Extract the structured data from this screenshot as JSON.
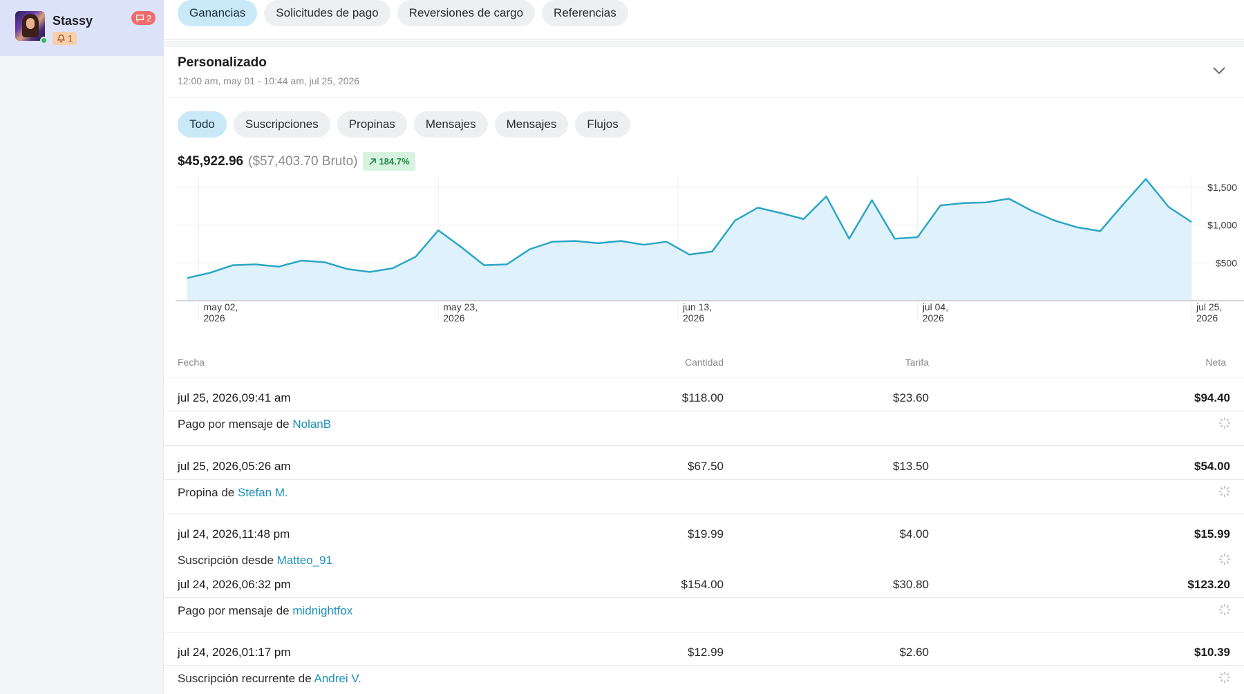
{
  "account": {
    "name": "Stassy",
    "messages_count": "2",
    "notifications_count": "1"
  },
  "tabs": [
    "Ganancias",
    "Solicitudes de pago",
    "Reversiones de cargo",
    "Referencias"
  ],
  "active_tab": "Ganancias",
  "range": {
    "title": "Personalizado",
    "subtitle": "12:00 am, may 01 - 10:44 am, jul 25, 2026"
  },
  "filters": [
    "Todo",
    "Suscripciones",
    "Propinas",
    "Mensajes",
    "Mensajes",
    "Flujos"
  ],
  "active_filter": "Todo",
  "summary": {
    "net": "$45,922.96",
    "gross": "($57,403.70 Bruto)",
    "trend": "184.7%"
  },
  "colors": {
    "accent": "#2aa6c4",
    "area_fill": "#dff1fb",
    "pill_active": "#c9e8f8",
    "link": "#1b8fb8"
  },
  "chart_data": {
    "type": "area",
    "x": [
      "may 01",
      "may 03",
      "may 05",
      "may 07",
      "may 09",
      "may 11",
      "may 13",
      "may 15",
      "may 17",
      "may 19",
      "may 21",
      "may 23",
      "may 25",
      "may 27",
      "may 29",
      "may 31",
      "jun 02",
      "jun 04",
      "jun 06",
      "jun 08",
      "jun 10",
      "jun 12",
      "jun 14",
      "jun 16",
      "jun 18",
      "jun 20",
      "jun 22",
      "jun 24",
      "jun 26",
      "jun 28",
      "jun 30",
      "jul 02",
      "jul 04",
      "jul 06",
      "jul 08",
      "jul 10",
      "jul 12",
      "jul 14",
      "jul 16",
      "jul 18",
      "jul 20",
      "jul 22",
      "jul 24",
      "jul 25"
    ],
    "values": [
      300,
      370,
      470,
      480,
      450,
      530,
      510,
      420,
      380,
      430,
      580,
      930,
      710,
      470,
      480,
      680,
      780,
      790,
      760,
      790,
      740,
      780,
      610,
      650,
      1060,
      1230,
      1160,
      1080,
      1380,
      820,
      1330,
      820,
      840,
      1260,
      1290,
      1300,
      1350,
      1190,
      1060,
      970,
      920,
      1270,
      1610,
      1240,
      1040
    ],
    "ylim": [
      0,
      1600
    ],
    "yticks": [
      "$500",
      "$1,000",
      "$1,500"
    ],
    "xticks": [
      {
        "line1": "may 02,",
        "line2": "2026"
      },
      {
        "line1": "may 23,",
        "line2": "2026"
      },
      {
        "line1": "jun 13,",
        "line2": "2026"
      },
      {
        "line1": "jul 04,",
        "line2": "2026"
      },
      {
        "line1": "jul 25,",
        "line2": "2026"
      }
    ],
    "grid": true
  },
  "table": {
    "headers": {
      "date": "Fecha",
      "amount": "Cantidad",
      "fee": "Tarifa",
      "net": "Neta"
    },
    "rows": [
      {
        "date": "jul 25, 2026,09:41 am",
        "amount": "$118.00",
        "fee": "$23.60",
        "net": "$94.40",
        "desc_prefix": "Pago por mensaje de",
        "user": "NolanB"
      },
      {
        "date": "jul 25, 2026,05:26 am",
        "amount": "$67.50",
        "fee": "$13.50",
        "net": "$54.00",
        "desc_prefix": "Propina de",
        "user": "Stefan M."
      },
      {
        "date": "jul 24, 2026,11:48 pm",
        "amount": "$19.99",
        "fee": "$4.00",
        "net": "$15.99",
        "desc_prefix": "Suscripción desde",
        "user": "Matteo_91"
      },
      {
        "date": "jul 24, 2026,06:32 pm",
        "amount": "$154.00",
        "fee": "$30.80",
        "net": "$123.20",
        "desc_prefix": "Pago por mensaje de",
        "user": "midnightfox"
      },
      {
        "date": "jul 24, 2026,01:17 pm",
        "amount": "$12.99",
        "fee": "$2.60",
        "net": "$10.39",
        "desc_prefix": "Suscripción recurrente de",
        "user": "Andrei V."
      }
    ]
  }
}
